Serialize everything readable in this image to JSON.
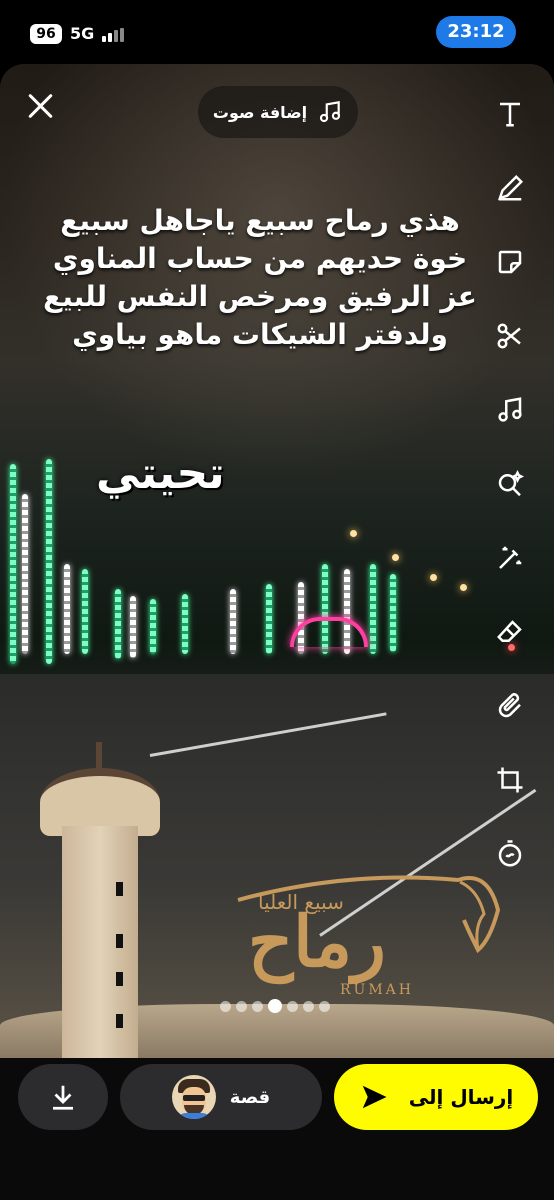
{
  "status_bar": {
    "battery": "96",
    "network": "5G",
    "time": "23:12"
  },
  "top_bar": {
    "close_icon": "close-icon",
    "add_sound_label": "إضافة صوت",
    "add_sound_icon": "music-note-icon"
  },
  "toolbar": {
    "tools": [
      {
        "name": "text-tool",
        "icon": "text-icon"
      },
      {
        "name": "draw-tool",
        "icon": "pencil-icon"
      },
      {
        "name": "sticker-tool",
        "icon": "sticker-icon"
      },
      {
        "name": "scissors-tool",
        "icon": "scissors-icon"
      },
      {
        "name": "music-tool",
        "icon": "music-note-icon"
      },
      {
        "name": "lens-tool",
        "icon": "search-sparkle-icon"
      },
      {
        "name": "magic-tool",
        "icon": "magic-wand-icon"
      },
      {
        "name": "eraser-tool",
        "icon": "eraser-icon"
      },
      {
        "name": "attach-tool",
        "icon": "paperclip-icon"
      },
      {
        "name": "crop-tool",
        "icon": "crop-icon"
      },
      {
        "name": "timer-tool",
        "icon": "timer-icon"
      }
    ]
  },
  "canvas": {
    "caption_lines": [
      "هذي رماح سبيع ياجاهل سبيع",
      "خوة حديهم من حساب المناوي",
      "عز الرفيق ومرخص النفس للبيع",
      "ولدفتر الشيكات ماهو بياوي"
    ],
    "sticker_text": "تحيتي",
    "logo_main": "رماح",
    "logo_sub": "سبيع العليا",
    "logo_latin": "RUMAH"
  },
  "pager": {
    "count": 7,
    "active_index": 3
  },
  "bottom_bar": {
    "download_icon": "download-icon",
    "story_label": "قصة",
    "send_label": "إرسال إلى",
    "send_icon": "send-arrow-icon"
  }
}
